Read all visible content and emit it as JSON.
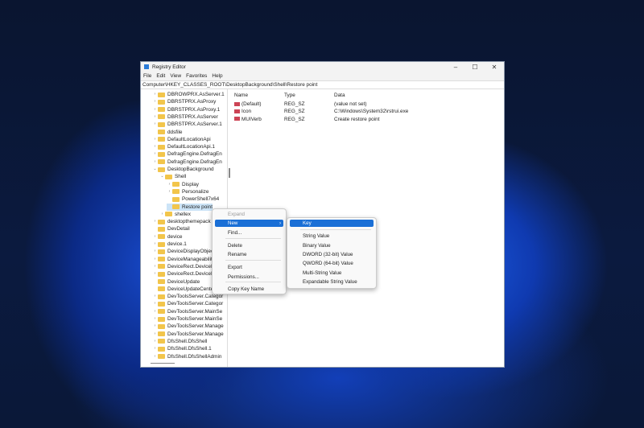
{
  "window": {
    "title": "Registry Editor",
    "controls": [
      "–",
      "☐",
      "✕"
    ]
  },
  "menu": [
    "File",
    "Edit",
    "View",
    "Favorites",
    "Help"
  ],
  "address": "Computer\\HKEY_CLASSES_ROOT\\DesktopBackground\\Shell\\Restore point",
  "tree": [
    {
      "label": "DBROWPRX.AsServer.1",
      "level": 0,
      "chev": "›"
    },
    {
      "label": "DBRSTPRX.AsProxy",
      "level": 0,
      "chev": "›"
    },
    {
      "label": "DBRSTPRX.AsProxy.1",
      "level": 0,
      "chev": "›"
    },
    {
      "label": "DBRSTPRX.AsServer",
      "level": 0,
      "chev": "›"
    },
    {
      "label": "DBRSTPRX.AsServer.1",
      "level": 0,
      "chev": "›"
    },
    {
      "label": "ddsfile",
      "level": 0,
      "chev": ""
    },
    {
      "label": "DefaultLocationApi",
      "level": 0,
      "chev": "›"
    },
    {
      "label": "DefaultLocationApi.1",
      "level": 0,
      "chev": "›"
    },
    {
      "label": "DefragEngine.DefragEn",
      "level": 0,
      "chev": "›"
    },
    {
      "label": "DefragEngine.DefragEn",
      "level": 0,
      "chev": "›"
    },
    {
      "label": "DesktopBackground",
      "level": 0,
      "chev": "⌄"
    },
    {
      "label": "Shell",
      "level": 1,
      "chev": "⌄"
    },
    {
      "label": "Display",
      "level": 2,
      "chev": "›"
    },
    {
      "label": "Personalize",
      "level": 2,
      "chev": "›"
    },
    {
      "label": "PowerShell7x64",
      "level": 2,
      "chev": ""
    },
    {
      "label": "Restore point",
      "level": 2,
      "chev": "",
      "selected": true
    },
    {
      "label": "shellex",
      "level": 1,
      "chev": "›"
    },
    {
      "label": "desktopthemepack",
      "level": 0,
      "chev": "›"
    },
    {
      "label": "DevDetail",
      "level": 0,
      "chev": ""
    },
    {
      "label": "device",
      "level": 0,
      "chev": "›"
    },
    {
      "label": "device.1",
      "level": 0,
      "chev": "›"
    },
    {
      "label": "DeviceDisplayObjec",
      "level": 0,
      "chev": "›"
    },
    {
      "label": "DeviceManageabilit",
      "level": 0,
      "chev": "›"
    },
    {
      "label": "DeviceRect.DeviceR",
      "level": 0,
      "chev": "›"
    },
    {
      "label": "DeviceRect.DeviceR",
      "level": 0,
      "chev": "›"
    },
    {
      "label": "DeviceUpdate",
      "level": 0,
      "chev": ""
    },
    {
      "label": "DeviceUpdateCente",
      "level": 0,
      "chev": ""
    },
    {
      "label": "DevToolsServer.Categor",
      "level": 0,
      "chev": "›"
    },
    {
      "label": "DevToolsServer.Categor",
      "level": 0,
      "chev": "›"
    },
    {
      "label": "DevToolsServer.MainSe",
      "level": 0,
      "chev": "›"
    },
    {
      "label": "DevToolsServer.MainSe",
      "level": 0,
      "chev": "›"
    },
    {
      "label": "DevToolsServer.Manage",
      "level": 0,
      "chev": "›"
    },
    {
      "label": "DevToolsServer.Manage",
      "level": 0,
      "chev": "›"
    },
    {
      "label": "DfsShell.DfsShell",
      "level": 0,
      "chev": "›"
    },
    {
      "label": "DfsShell.DfsShell.1",
      "level": 0,
      "chev": "›"
    },
    {
      "label": "DfsShell.DfsShellAdmin",
      "level": 0,
      "chev": "›"
    }
  ],
  "columns": [
    "Name",
    "Type",
    "Data"
  ],
  "values": [
    {
      "name": "(Default)",
      "type": "REG_SZ",
      "data": "(value not set)"
    },
    {
      "name": "Icon",
      "type": "REG_SZ",
      "data": "C:\\Windows\\System32\\rstrui.exe"
    },
    {
      "name": "MUIVerb",
      "type": "REG_SZ",
      "data": "Create restore point"
    }
  ],
  "context_menu": [
    "Expand",
    "New",
    "Find...",
    "Delete",
    "Rename",
    "Export",
    "Permissions...",
    "Copy Key Name"
  ],
  "submenu": [
    "Key",
    "String Value",
    "Binary Value",
    "DWORD (32-bit) Value",
    "QWORD (64-bit) Value",
    "Multi-String Value",
    "Expandable String Value"
  ]
}
